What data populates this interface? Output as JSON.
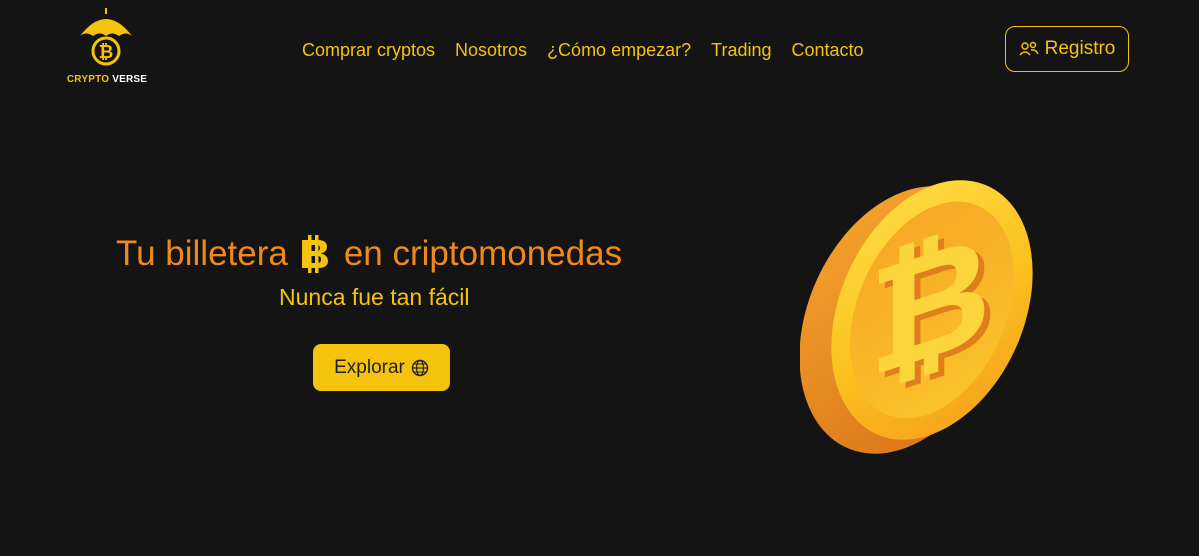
{
  "brand": {
    "word1": "CRYPTO",
    "word2": "VERSE"
  },
  "nav": [
    {
      "label": "Comprar cryptos"
    },
    {
      "label": "Nosotros"
    },
    {
      "label": "¿Cómo empezar?"
    },
    {
      "label": "Trading"
    },
    {
      "label": "Contacto"
    }
  ],
  "register": {
    "label": "Registro",
    "icon": "users-icon"
  },
  "hero": {
    "title_before": "Tu billetera",
    "title_after": "en criptomonedas",
    "subtitle": "Nunca fue tan fácil",
    "explore_label": "Explorar",
    "explore_icon": "globe-icon"
  },
  "colors": {
    "accent": "#f5c20c",
    "orange": "#f0891b",
    "background": "#141414"
  }
}
